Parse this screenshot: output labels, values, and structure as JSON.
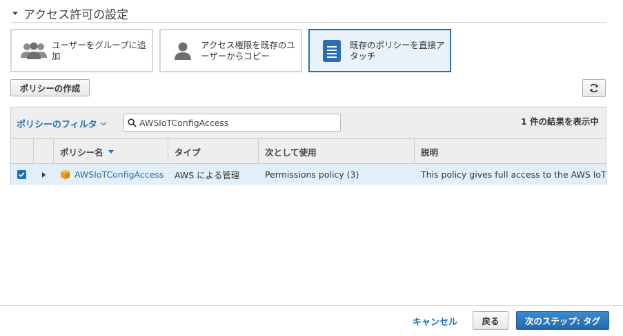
{
  "section": {
    "title": "アクセス許可の設定"
  },
  "options": [
    {
      "label": "ユーザーをグループに追加",
      "icon": "users-group-icon",
      "selected": false
    },
    {
      "label": "アクセス権限を既存のユーザーからコピー",
      "icon": "user-icon",
      "selected": false
    },
    {
      "label": "既存のポリシーを直接アタッチ",
      "icon": "document-icon",
      "selected": true
    }
  ],
  "toolbar": {
    "create_policy_label": "ポリシーの作成",
    "refresh_icon": "refresh-icon"
  },
  "filter": {
    "label": "ポリシーのフィルタ",
    "search_value": "AWSIoTConfigAccess",
    "result_count": "1 件の結果を表示中"
  },
  "table": {
    "headers": {
      "name": "ポリシー名",
      "type": "タイプ",
      "used_as": "次として使用",
      "description": "説明"
    },
    "rows": [
      {
        "checked": true,
        "name": "AWSIoTConfigAccess",
        "type": "AWS による管理",
        "used_as": "Permissions policy (3)",
        "description": "This policy gives full access to the AWS IoT ..."
      }
    ]
  },
  "footer": {
    "cancel_label": "キャンセル",
    "back_label": "戻る",
    "next_label": "次のステップ: タグ"
  },
  "colors": {
    "accent": "#1f6fb5",
    "selected_bg": "#e9f2fb",
    "row_selected": "#e2eff9",
    "policy_icon": "#f3a01c"
  }
}
